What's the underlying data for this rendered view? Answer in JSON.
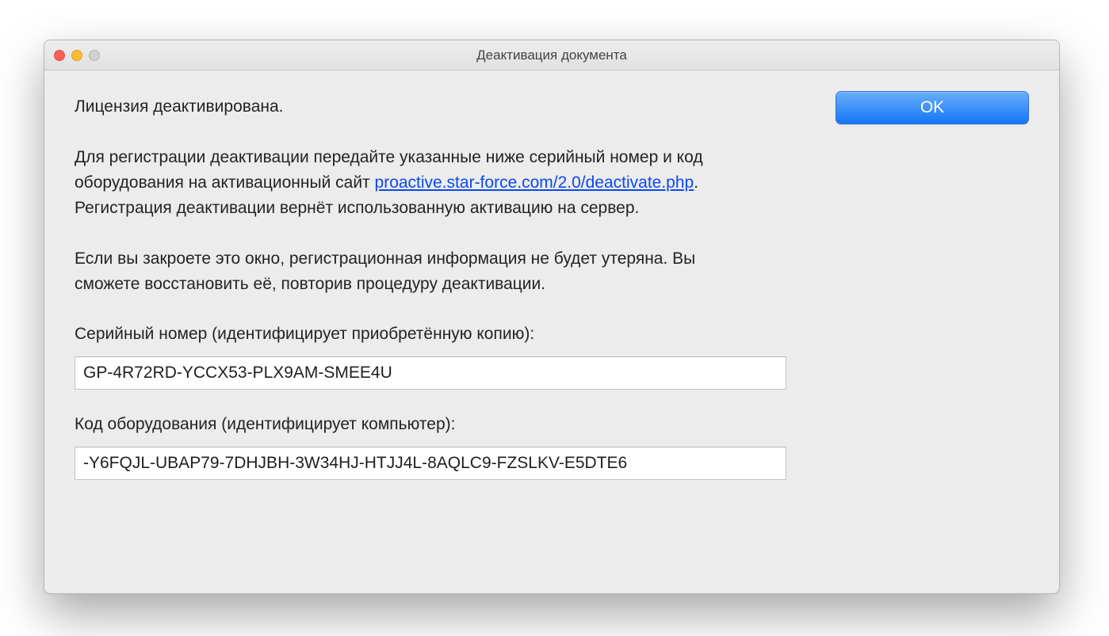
{
  "window": {
    "title": "Деактивация документа"
  },
  "traffic": {
    "close": "close",
    "minimize": "minimize",
    "zoom": "zoom"
  },
  "messages": {
    "deactivated": "Лицензия деактивирована.",
    "instruction_before_link": "Для регистрации деактивации передайте указанные ниже серийный номер и код оборудования на активационный сайт ",
    "link_text": "proactive.star-force.com/2.0/deactivate.php",
    "instruction_after_link": ". Регистрация деактивации вернёт использованную активацию на сервер.",
    "close_warning": "Если вы закроете это окно, регистрационная информация не будет утеряна. Вы сможете восстановить её, повторив процедуру деактивации."
  },
  "serial": {
    "label": "Серийный номер (идентифицирует приобретённую копию):",
    "value": "GP-4R72RD-YCCX53-PLX9AM-SMEE4U"
  },
  "hardware": {
    "label": "Код оборудования (идентифицирует компьютер):",
    "value": "-Y6FQJL-UBAP79-7DHJBH-3W34HJ-HTJJ4L-8AQLC9-FZSLKV-E5DTE6"
  },
  "buttons": {
    "ok": "OK"
  }
}
